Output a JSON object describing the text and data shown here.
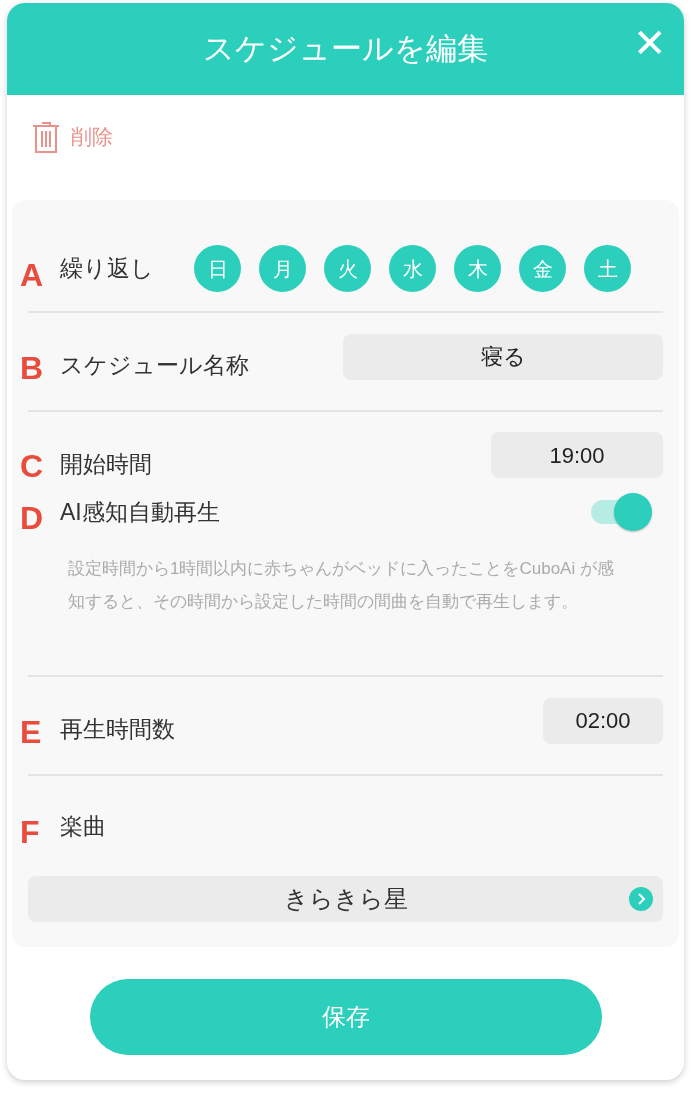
{
  "header": {
    "title": "スケジュールを編集",
    "close": "✕"
  },
  "delete": {
    "label": "削除"
  },
  "repeat": {
    "marker": "A",
    "label": "繰り返し",
    "days": [
      {
        "label": "日",
        "selected": true
      },
      {
        "label": "月",
        "selected": true
      },
      {
        "label": "火",
        "selected": true
      },
      {
        "label": "水",
        "selected": true
      },
      {
        "label": "木",
        "selected": true
      },
      {
        "label": "金",
        "selected": true
      },
      {
        "label": "土",
        "selected": true
      }
    ]
  },
  "name": {
    "marker": "B",
    "label": "スケジュール名称",
    "value": "寝る"
  },
  "start": {
    "marker": "C",
    "label": "開始時間",
    "value": "19:00"
  },
  "auto_play": {
    "marker": "D",
    "label": "AI感知自動再生",
    "on": true,
    "description": "設定時間から1時間以内に赤ちゃんがベッドに入ったことをCuboAi が感知すると、その時間から設定した時間の間曲を自動で再生します。"
  },
  "duration": {
    "marker": "E",
    "label": "再生時間数",
    "value": "02:00"
  },
  "music": {
    "marker": "F",
    "label": "楽曲",
    "value": "きらきら星"
  },
  "save_button": "保存"
}
